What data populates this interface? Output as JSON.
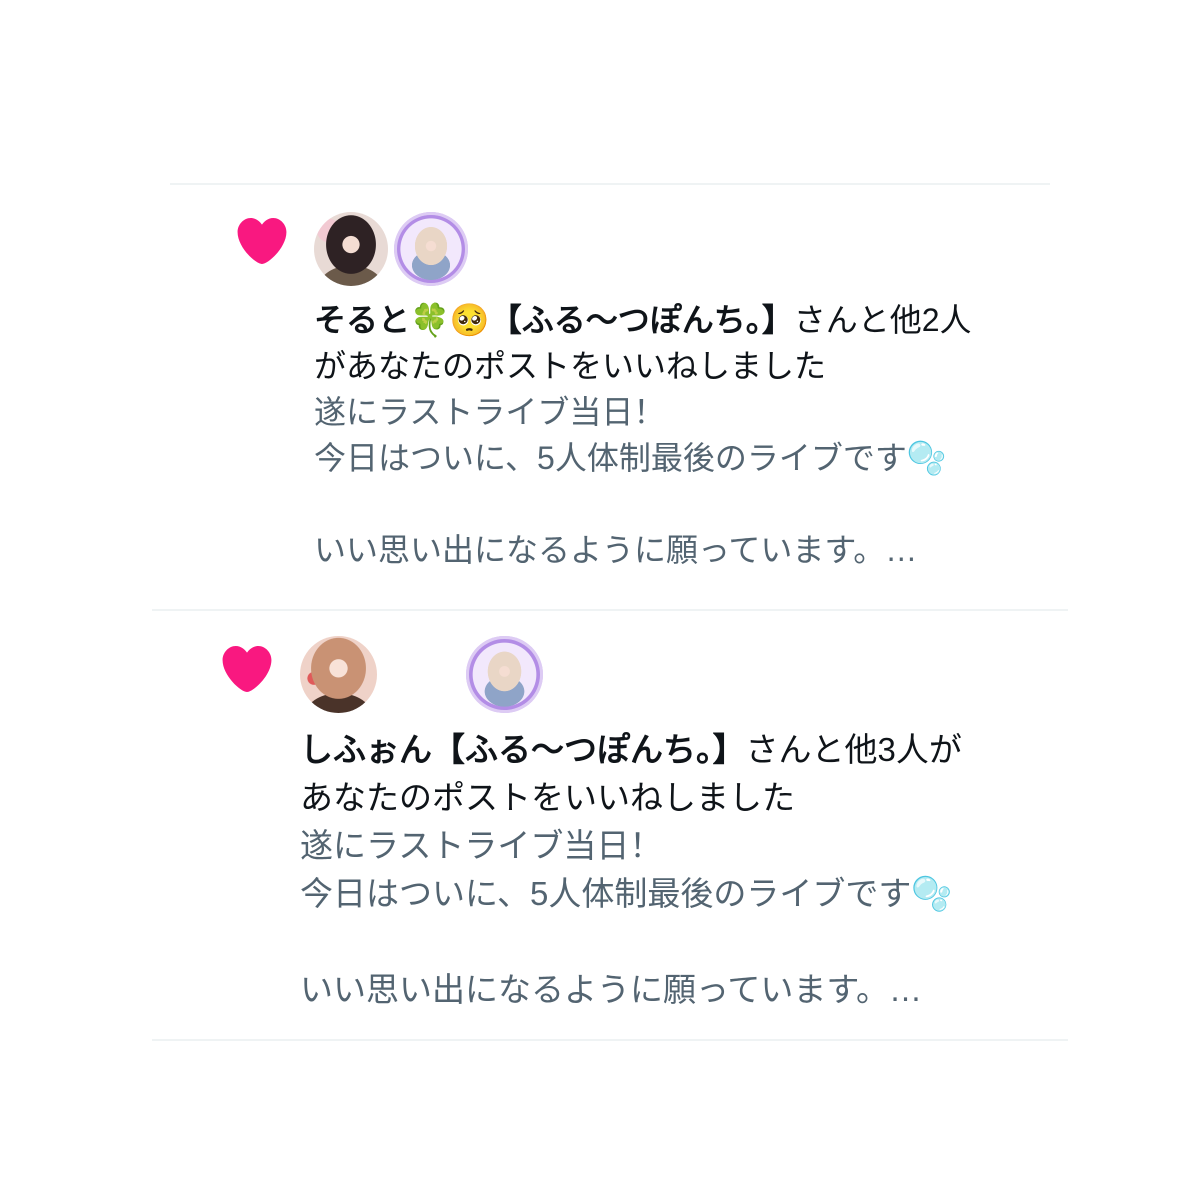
{
  "colors": {
    "like": "#f91880",
    "text": "#0f1419",
    "secondary": "#536471",
    "divider": "#eff3f4"
  },
  "notifications": [
    {
      "icon": "heart-icon",
      "avatars": [
        {
          "color": "#e8dad5"
        },
        {
          "color": "#b38de6"
        }
      ],
      "actor_name": "そると🍀🥺【ふる〜つぽんち。】",
      "action_line1": "さんと他2人",
      "action_line2": "があなたのポストをいいねしました",
      "preview_lines": [
        "遂にラストライブ当日！",
        "今日はついに、5人体制最後のライブです🫧",
        "いい思い出になるように願っています。…"
      ]
    },
    {
      "icon": "heart-icon",
      "avatars": [
        {
          "color": "#efd2c8"
        },
        {
          "color": "#ffffff"
        },
        {
          "color": "#b38de6"
        }
      ],
      "actor_name": "しふぉん【ふる〜つぽんち。】",
      "action_line1": "さんと他3人が",
      "action_line2": "あなたのポストをいいねしました",
      "preview_lines": [
        "遂にラストライブ当日！",
        "今日はついに、5人体制最後のライブです🫧",
        "いい思い出になるように願っています。…"
      ]
    }
  ]
}
